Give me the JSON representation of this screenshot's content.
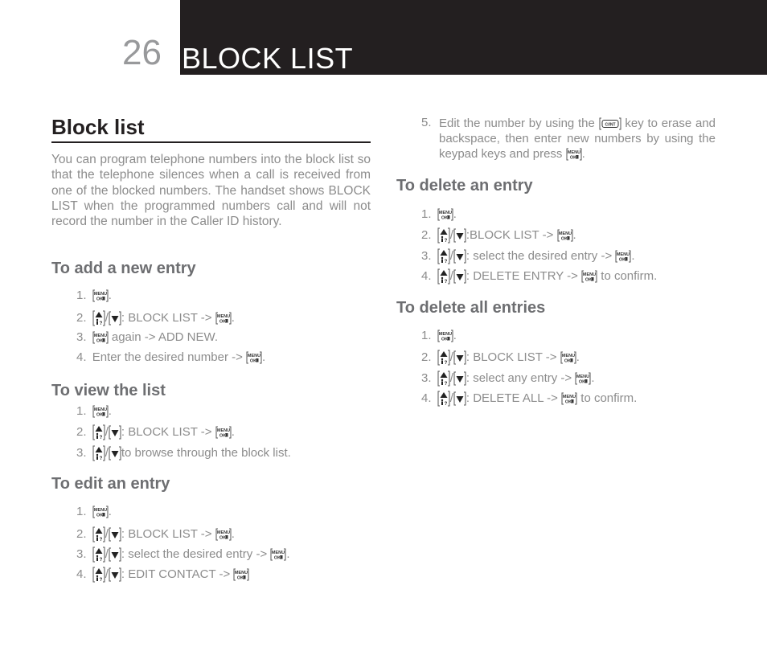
{
  "header": {
    "page_number": "26",
    "chapter_title": "BLOCK LIST"
  },
  "left": {
    "title": "Block list",
    "intro": "You can program telephone numbers into the block list so that the telephone silences when a call is received from one of the blocked numbers. The handset shows BLOCK LIST when the programmed numbers call and will not record the number in the Caller ID history.",
    "add": {
      "heading": "To add a new entry",
      "steps": [
        {
          "n": "1.",
          "parts": [
            "menu",
            "."
          ]
        },
        {
          "n": "2.",
          "parts": [
            "up",
            "/",
            "down",
            ": BLOCK LIST -> ",
            "menu",
            "."
          ]
        },
        {
          "n": "3.",
          "parts": [
            "menu",
            " again -> ADD NEW."
          ]
        },
        {
          "n": "4.",
          "parts": [
            "Enter the desired number -> ",
            "menu",
            "."
          ]
        }
      ]
    },
    "view": {
      "heading": "To view the list",
      "steps": [
        {
          "n": "1.",
          "parts": [
            "menu",
            "."
          ]
        },
        {
          "n": "2.",
          "parts": [
            "up",
            "/",
            "down",
            ": BLOCK LIST -> ",
            "menu",
            "."
          ]
        },
        {
          "n": "3.",
          "parts": [
            "up",
            "/",
            "down",
            "to browse through the block list."
          ]
        }
      ]
    },
    "edit": {
      "heading": "To edit an entry",
      "steps": [
        {
          "n": "1.",
          "parts": [
            "menu",
            "."
          ]
        },
        {
          "n": "2.",
          "parts": [
            "up",
            "/",
            "down",
            ": BLOCK LIST -> ",
            "menu",
            "."
          ]
        },
        {
          "n": "3.",
          "parts": [
            "up",
            "/",
            "down",
            ": select the desired entry -> ",
            "menu",
            "."
          ]
        },
        {
          "n": "4.",
          "parts": [
            "up",
            "/",
            "down",
            ": EDIT CONTACT -> ",
            "menu",
            ""
          ]
        }
      ]
    }
  },
  "right": {
    "edit_step5": {
      "n": "5.",
      "parts": [
        "Edit the number by using the ",
        "c",
        " key to erase and backspace, then enter new numbers by using the keypad keys and press ",
        "menu",
        "."
      ]
    },
    "delete": {
      "heading": "To delete an entry",
      "steps": [
        {
          "n": "1.",
          "parts": [
            "menu",
            "."
          ]
        },
        {
          "n": "2.",
          "parts": [
            "up",
            "/",
            "down",
            ":BLOCK LIST -> ",
            "menu",
            "."
          ]
        },
        {
          "n": "3.",
          "parts": [
            "up",
            "/",
            "down",
            ": select the desired entry -> ",
            "menu",
            "."
          ]
        },
        {
          "n": "4.",
          "parts": [
            "up",
            "/",
            "down",
            ": DELETE ENTRY -> ",
            "menu",
            " to confirm."
          ]
        }
      ]
    },
    "delete_all": {
      "heading": "To delete all entries",
      "steps": [
        {
          "n": "1.",
          "parts": [
            "menu",
            "."
          ]
        },
        {
          "n": "2.",
          "parts": [
            "up",
            "/",
            "down",
            ": BLOCK LIST -> ",
            "menu",
            "."
          ]
        },
        {
          "n": "3.",
          "parts": [
            "up",
            "/",
            "down",
            ": select any entry -> ",
            "menu",
            "."
          ]
        },
        {
          "n": "4.",
          "parts": [
            "up",
            "/",
            "down",
            ": DELETE ALL -> ",
            "menu",
            " to confirm."
          ]
        }
      ]
    }
  },
  "key_icons": {
    "menu": {
      "name": "menu-ok-key-icon",
      "line1": "MENU",
      "line2": "OK"
    },
    "up": {
      "name": "up-key-icon"
    },
    "down": {
      "name": "down-key-icon"
    },
    "c": {
      "name": "clear-key-icon",
      "label": "C/INT"
    }
  }
}
